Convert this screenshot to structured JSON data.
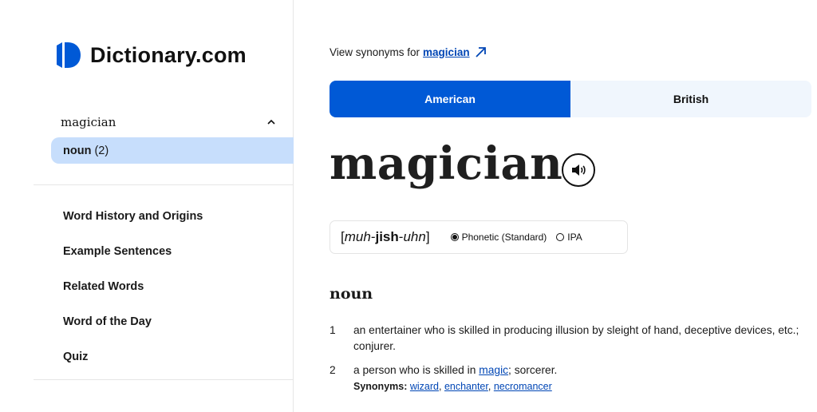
{
  "brand": {
    "name": "Dictionary.com",
    "logo_icon": "dictionary-logo-icon",
    "accent": "#0059d6"
  },
  "sidebar": {
    "word": "magician",
    "part_of_speech": {
      "label": "noun",
      "count": "(2)"
    },
    "nav": [
      "Word History and Origins",
      "Example Sentences",
      "Related Words",
      "Word of the Day",
      "Quiz"
    ]
  },
  "main": {
    "view_synonyms_prefix": "View synonyms for",
    "view_synonyms_link": "magician",
    "tabs": [
      "American",
      "British"
    ],
    "active_tab": "American",
    "headword": "magician",
    "pronunciation": {
      "pre": "[",
      "p1": "muh",
      "sep1": "-",
      "p2": "jish",
      "sep2": "-",
      "p3": "uhn",
      "post": "]"
    },
    "pron_options": [
      "Phonetic (Standard)",
      "IPA"
    ],
    "pron_selected": "Phonetic (Standard)",
    "pos_heading": "noun",
    "definitions": [
      {
        "num": "1",
        "text": "an entertainer who is skilled in producing illusion by sleight of hand, deceptive devices, etc.; conjurer."
      },
      {
        "num": "2",
        "pre": "a person who is skilled in",
        "link": "magic",
        "post": "; sorcerer."
      }
    ],
    "synonyms_label": "Synonyms:",
    "synonyms": [
      "wizard",
      "enchanter",
      "necromancer"
    ]
  }
}
